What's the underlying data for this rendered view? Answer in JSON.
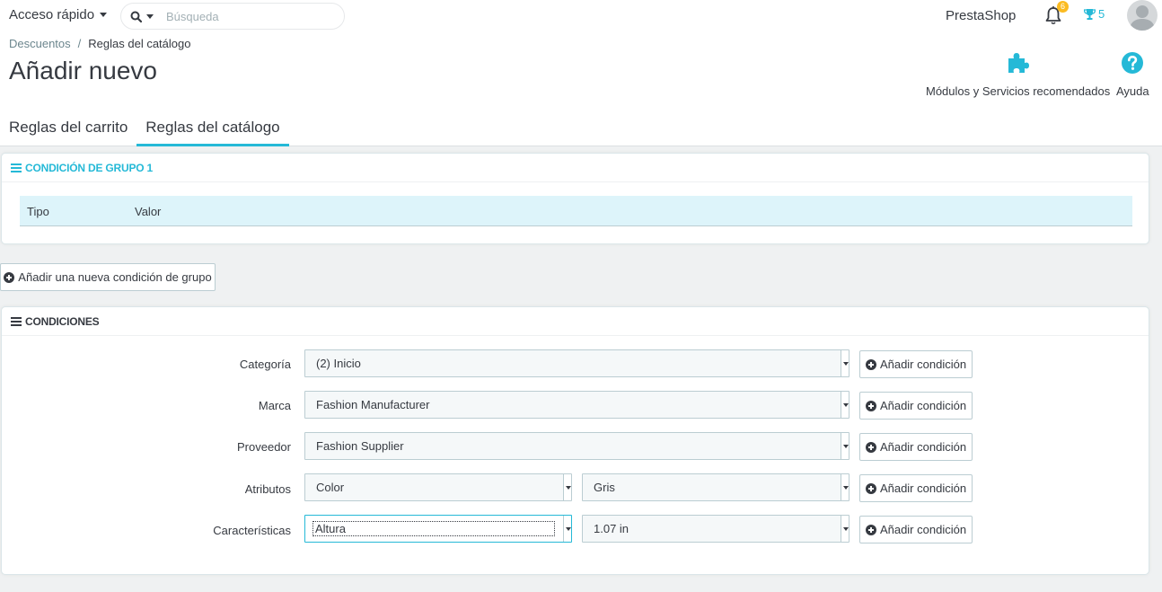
{
  "topbar": {
    "quick_access": "Acceso rápido",
    "search_placeholder": "Búsqueda",
    "shop_name": "PrestaShop",
    "notifications_count": "6",
    "trophy_count": "5"
  },
  "breadcrumb": {
    "parent": "Descuentos",
    "separator": "/",
    "current": "Reglas del catálogo"
  },
  "page_title": "Añadir nuevo",
  "toolbar": {
    "modules_label": "Módulos y Servicios recomendados",
    "help_label": "Ayuda"
  },
  "tabs": [
    {
      "label": "Reglas del carrito",
      "active": false
    },
    {
      "label": "Reglas del catálogo",
      "active": true
    }
  ],
  "group_panel": {
    "title": "CONDICIÓN DE GRUPO 1",
    "columns": [
      "Tipo",
      "Valor"
    ]
  },
  "add_group_label": "Añadir una nueva condición de grupo",
  "conditions_panel": {
    "title": "CONDICIONES",
    "add_label": "Añadir condición",
    "rows": [
      {
        "label": "Categoría",
        "selects": [
          "(2) Inicio"
        ]
      },
      {
        "label": "Marca",
        "selects": [
          "Fashion Manufacturer"
        ]
      },
      {
        "label": "Proveedor",
        "selects": [
          "Fashion Supplier"
        ]
      },
      {
        "label": "Atributos",
        "selects": [
          "Color",
          "Gris"
        ]
      },
      {
        "label": "Características",
        "selects": [
          "Altura",
          "1.07 in"
        ]
      }
    ]
  },
  "colors": {
    "accent": "#25b9d7",
    "badge": "#fbbb22",
    "text": "#363a41"
  }
}
